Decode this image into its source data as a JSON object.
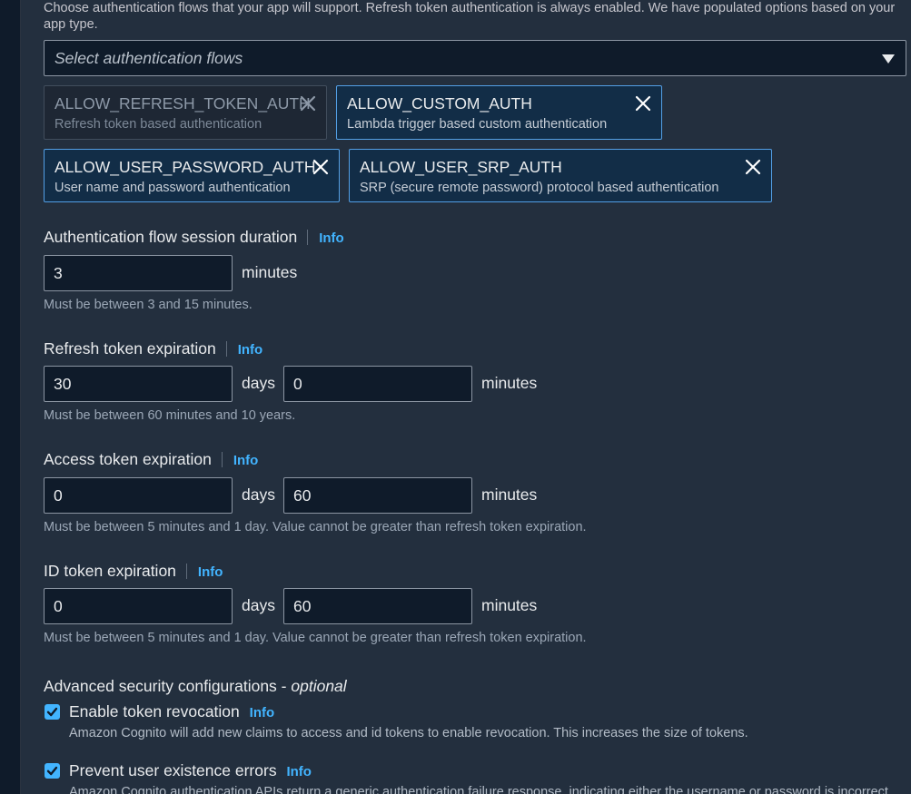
{
  "auth_flows": {
    "description": "Choose authentication flows that your app will support. Refresh token authentication is always enabled. We have populated options based on your app type.",
    "select_placeholder": "Select authentication flows",
    "tokens": [
      {
        "name": "ALLOW_REFRESH_TOKEN_AUTH",
        "desc": "Refresh token based authentication",
        "disabled": true
      },
      {
        "name": "ALLOW_CUSTOM_AUTH",
        "desc": "Lambda trigger based custom authentication"
      },
      {
        "name": "ALLOW_USER_PASSWORD_AUTH",
        "desc": "User name and password authentication"
      },
      {
        "name": "ALLOW_USER_SRP_AUTH",
        "desc": "SRP (secure remote password) protocol based authentication"
      }
    ]
  },
  "session_duration": {
    "label": "Authentication flow session duration",
    "info": "Info",
    "value": "3",
    "unit": "minutes",
    "hint": "Must be between 3 and 15 minutes."
  },
  "refresh_token": {
    "label": "Refresh token expiration",
    "info": "Info",
    "days_value": "30",
    "days_unit": "days",
    "minutes_value": "0",
    "minutes_unit": "minutes",
    "hint": "Must be between 60 minutes and 10 years."
  },
  "access_token": {
    "label": "Access token expiration",
    "info": "Info",
    "days_value": "0",
    "days_unit": "days",
    "minutes_value": "60",
    "minutes_unit": "minutes",
    "hint": "Must be between 5 minutes and 1 day. Value cannot be greater than refresh token expiration."
  },
  "id_token": {
    "label": "ID token expiration",
    "info": "Info",
    "days_value": "0",
    "days_unit": "days",
    "minutes_value": "60",
    "minutes_unit": "minutes",
    "hint": "Must be between 5 minutes and 1 day. Value cannot be greater than refresh token expiration."
  },
  "advanced": {
    "title": "Advanced security configurations -",
    "optional": "optional",
    "token_revocation": {
      "label": "Enable token revocation",
      "info": "Info",
      "checked": true,
      "desc": "Amazon Cognito will add new claims to access and id tokens to enable revocation. This increases the size of tokens."
    },
    "prevent_existence": {
      "label": "Prevent user existence errors",
      "info": "Info",
      "checked": true,
      "desc": "Amazon Cognito authentication APIs return a generic authentication failure response, indicating either the username or password is incorrect."
    }
  }
}
